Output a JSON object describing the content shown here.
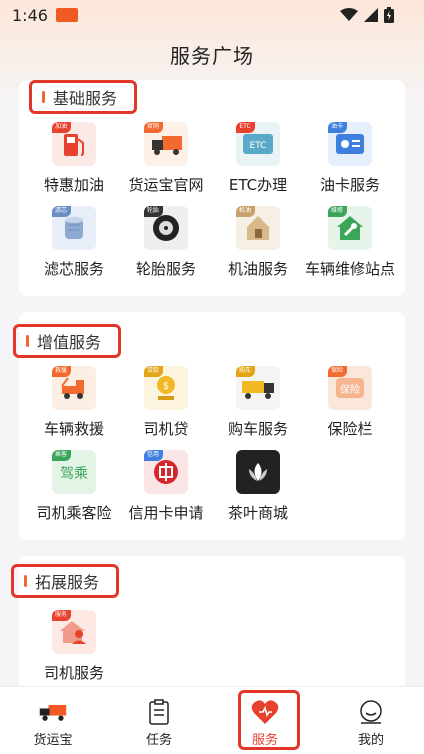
{
  "status": {
    "time": "1:46"
  },
  "header": {
    "title": "服务广场"
  },
  "sections": [
    {
      "title": "基础服务",
      "items": [
        {
          "label": "特惠加油",
          "tag": "加油",
          "icon": "fuel-pump-icon",
          "color": "#e8412d"
        },
        {
          "label": "货运宝官网",
          "tag": "官网",
          "icon": "truck-icon",
          "color": "#f26a2f"
        },
        {
          "label": "ETC办理",
          "tag": "ETC",
          "icon": "etc-card-icon",
          "color": "#5aa9c9"
        },
        {
          "label": "油卡服务",
          "tag": "油卡",
          "icon": "fuel-card-icon",
          "color": "#3f7fe0"
        },
        {
          "label": "滤芯服务",
          "tag": "滤芯",
          "icon": "filter-icon",
          "color": "#6a8fc4"
        },
        {
          "label": "轮胎服务",
          "tag": "轮胎",
          "icon": "tire-icon",
          "color": "#333333"
        },
        {
          "label": "机油服务",
          "tag": "机油",
          "icon": "engine-oil-icon",
          "color": "#c9a26a"
        },
        {
          "label": "车辆维修站点",
          "tag": "维修",
          "icon": "repair-house-icon",
          "color": "#3aa65a"
        }
      ]
    },
    {
      "title": "增值服务",
      "items": [
        {
          "label": "车辆救援",
          "tag": "救援",
          "icon": "tow-truck-icon",
          "color": "#f26a2f"
        },
        {
          "label": "司机贷",
          "tag": "贷款",
          "icon": "coin-stack-icon",
          "color": "#e5a51b"
        },
        {
          "label": "购车服务",
          "tag": "购车",
          "icon": "semi-truck-icon",
          "color": "#e5a51b"
        },
        {
          "label": "保险栏",
          "tag": "保险",
          "icon": "insurance-icon",
          "color": "#f26a2f"
        },
        {
          "label": "司机乘客险",
          "tag": "乘客",
          "icon": "passenger-insurance-icon",
          "color": "#3aa65a"
        },
        {
          "label": "信用卡申请",
          "tag": "信用",
          "icon": "citic-bank-icon",
          "color": "#d7262c"
        },
        {
          "label": "茶叶商城",
          "tag": "",
          "icon": "tea-leaf-icon",
          "color": "#222222"
        }
      ]
    },
    {
      "title": "拓展服务",
      "items": [
        {
          "label": "司机服务",
          "tag": "服务",
          "icon": "driver-home-icon",
          "color": "#e8412d"
        }
      ]
    }
  ],
  "tabs": [
    {
      "label": "货运宝",
      "icon": "truck-logo-icon"
    },
    {
      "label": "任务",
      "icon": "clipboard-icon"
    },
    {
      "label": "服务",
      "icon": "heart-icon",
      "active": true
    },
    {
      "label": "我的",
      "icon": "smile-face-icon"
    }
  ]
}
